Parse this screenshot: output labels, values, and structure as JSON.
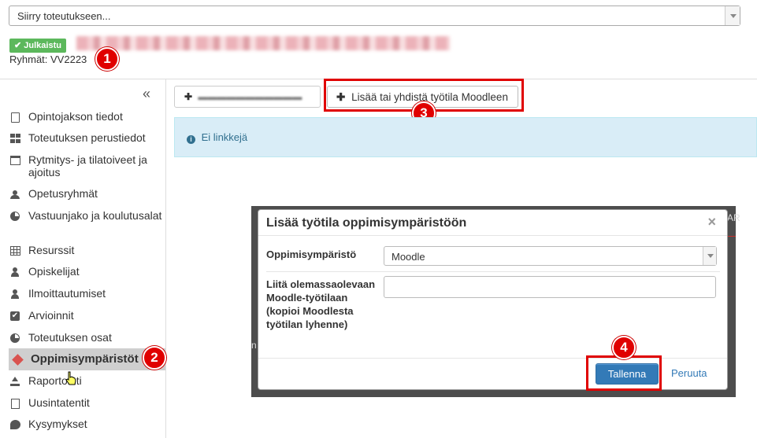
{
  "top_select": {
    "value": "Siirry toteutukseen..."
  },
  "status_badge": "✔ Julkaistu",
  "groups_text": "Ryhmät: VV2223",
  "markers": [
    "1",
    "2",
    "3",
    "4"
  ],
  "collapse_glyph": "«",
  "sidebar": {
    "items": [
      {
        "label": "Opintojakson tiedot",
        "icon": "document-icon"
      },
      {
        "label": "Toteutuksen perustiedot",
        "icon": "grid-icon"
      },
      {
        "label": "Rytmitys- ja tilatoiveet ja ajoitus",
        "icon": "calendar-icon"
      },
      {
        "label": "Opetusryhmät",
        "icon": "users-icon"
      },
      {
        "label": "Vastuunjako ja koulutusalat",
        "icon": "pie-chart-icon"
      },
      {
        "label": "Resurssit",
        "icon": "table-icon"
      },
      {
        "label": "Opiskelijat",
        "icon": "user-icon"
      },
      {
        "label": "Ilmoittautumiset",
        "icon": "user-icon"
      },
      {
        "label": "Arvioinnit",
        "icon": "checkbox-icon"
      },
      {
        "label": "Toteutuksen osat",
        "icon": "pie-chart-icon"
      },
      {
        "label": "Oppimisympäristöt",
        "icon": "cube-icon",
        "active": true
      },
      {
        "label": "Raportointi",
        "icon": "upload-icon"
      },
      {
        "label": "Uusintatentit",
        "icon": "file-icon"
      },
      {
        "label": "Kysymykset",
        "icon": "comment-icon"
      }
    ]
  },
  "toolbar": {
    "add_moodle_label": "Lisää tai yhdistä työtila Moodleen"
  },
  "alert": {
    "text": "Ei linkkejä"
  },
  "modal": {
    "title": "Lisää työtila oppimisympäristöön",
    "close": "×",
    "env_label": "Oppimisympäristö",
    "env_value": "Moodle",
    "link_label": "Liitä olemassaolevaan Moodle-työtilaan (kopioi Moodlesta työtilan lyhenne)",
    "link_value": "",
    "save_label": "Tallenna",
    "cancel_label": "Peruuta"
  },
  "colors": {
    "badge": "#5cb85c",
    "marker": "#e00000",
    "alert_bg": "#d9edf7",
    "primary": "#337ab7",
    "active_nav_icon": "#d9534f"
  }
}
